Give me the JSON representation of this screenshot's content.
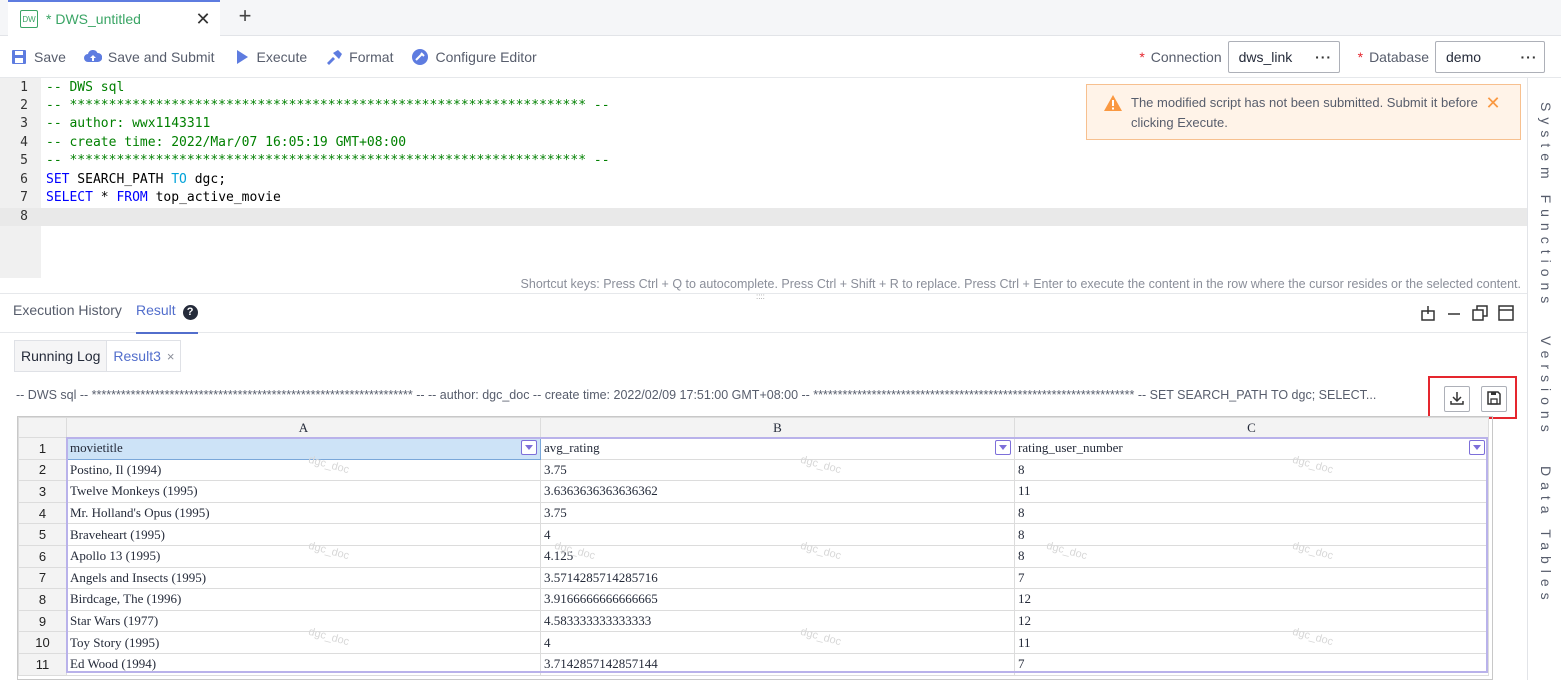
{
  "tab": {
    "icon_text": "DW",
    "name": "* DWS_untitled",
    "close": "✕",
    "add": "+"
  },
  "toolbar": {
    "save": "Save",
    "save_submit": "Save and Submit",
    "execute": "Execute",
    "format": "Format",
    "configure": "Configure Editor",
    "connection_label": "Connection",
    "connection_value": "dws_link",
    "database_label": "Database",
    "database_value": "demo",
    "required_mark": "*",
    "more": "···"
  },
  "editor": {
    "lines": [
      {
        "n": "1",
        "text": "-- DWS sql"
      },
      {
        "n": "2",
        "text": "-- ****************************************************************** --"
      },
      {
        "n": "3",
        "text": "-- author: wwx1143311"
      },
      {
        "n": "4",
        "text": "-- create time: 2022/Mar/07 16:05:19 GMT+08:00"
      },
      {
        "n": "5",
        "text": "-- ****************************************************************** --"
      },
      {
        "n": "6",
        "kw1": "SET",
        "mid": " SEARCH_PATH ",
        "kw2": "TO",
        "rest": " dgc;"
      },
      {
        "n": "7",
        "kw1": "SELECT",
        "mid": " * ",
        "kw2": "FROM",
        "rest": " top_active_movie"
      },
      {
        "n": "8",
        "text": ""
      }
    ],
    "shortcut_hint": "Shortcut keys: Press Ctrl + Q to autocomplete. Press Ctrl + Shift + R to replace. Press Ctrl + Enter to execute the content in the row where the cursor resides or the selected content.",
    "splitter": "::::"
  },
  "warning": {
    "text": "The modified script has not been submitted. Submit it before clicking Execute.",
    "close": "✕"
  },
  "sidebar": [
    "System Functions",
    "Versions",
    "Data Tables"
  ],
  "result": {
    "tabs": [
      "Execution History",
      "Result"
    ],
    "subtabs": [
      "Running Log",
      "Result3"
    ],
    "subtab_close": "×",
    "sql_preview": "-- DWS sql -- ****************************************************************** -- -- author: dgc_doc -- create time: 2022/02/09 17:51:00 GMT+08:00 -- ****************************************************************** -- SET SEARCH_PATH TO dgc; SELECT..."
  },
  "grid": {
    "col_letters": [
      "A",
      "B",
      "C"
    ],
    "watermark": "dgc_doc",
    "rows": [
      {
        "n": "1",
        "a": "movietitle",
        "b": "avg_rating",
        "c": "rating_user_number"
      },
      {
        "n": "2",
        "a": "Postino, Il (1994)",
        "b": "3.75",
        "c": "8"
      },
      {
        "n": "3",
        "a": "Twelve Monkeys (1995)",
        "b": "3.6363636363636362",
        "c": "11"
      },
      {
        "n": "4",
        "a": "Mr. Holland's Opus (1995)",
        "b": "3.75",
        "c": "8"
      },
      {
        "n": "5",
        "a": "Braveheart (1995)",
        "b": "4",
        "c": "8"
      },
      {
        "n": "6",
        "a": "Apollo 13 (1995)",
        "b": "4.125",
        "c": "8"
      },
      {
        "n": "7",
        "a": "Angels and Insects (1995)",
        "b": "3.5714285714285716",
        "c": "7"
      },
      {
        "n": "8",
        "a": "Birdcage, The (1996)",
        "b": "3.9166666666666665",
        "c": "12"
      },
      {
        "n": "9",
        "a": "Star Wars (1977)",
        "b": "4.583333333333333",
        "c": "12"
      },
      {
        "n": "10",
        "a": "Toy Story (1995)",
        "b": "4",
        "c": "11"
      },
      {
        "n": "11",
        "a": "Ed Wood (1994)",
        "b": "3.7142857142857144",
        "c": "7"
      }
    ]
  },
  "colors": {
    "accent": "#526ecc",
    "tab_green": "#3aa565",
    "warn_orange": "#fa9841",
    "highlight_red": "#e5262e"
  }
}
